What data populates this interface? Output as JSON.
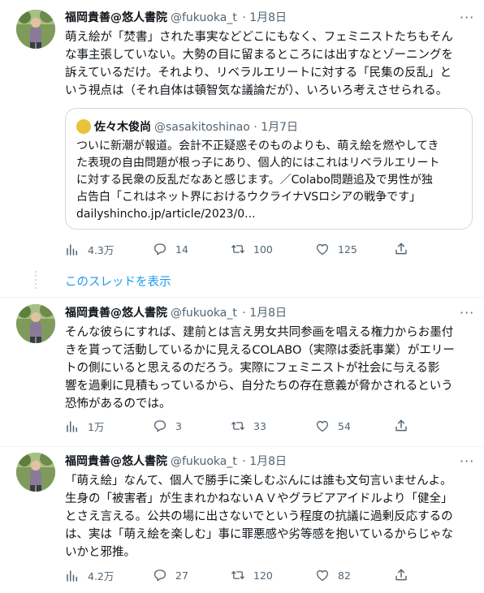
{
  "tweets": [
    {
      "name": "福岡貴善@悠人書院",
      "handle": "@fukuoka_t",
      "date": "· 1月8日",
      "text": "萌え絵が「焚書」された事実などどこにもなく、フェミニストたちもそん\nな事主張していない。大勢の目に留まるところには出すなとゾーニングを\n訴えているだけ。それより、リベラルエリートに対する「民集の反乱」と\nいう視点は（それ自体は頓智気な議論だが）、いろいろ考えさせられる。",
      "quote": {
        "name": "佐々木俊尚",
        "handle": "@sasakitoshinao",
        "date": "· 1月7日",
        "text": "ついに新潮が報道。会計不正疑惑そのものよりも、萌え絵を燃やしてき\nた表現の自由問題が根っ子にあり、個人的にはこれはリベラルエリート\nに対する民衆の反乱だなあと感じます。／Colabo問題追及で男性が独\n占告白「これはネット界におけるウクライナVSロシアの戦争です」\ndailyshincho.jp/article/2023/0..."
      },
      "views": "4.3万",
      "replies": "14",
      "retweets": "100",
      "likes": "125"
    },
    {
      "name": "福岡貴善@悠人書院",
      "handle": "@fukuoka_t",
      "date": "· 1月8日",
      "text": "そんな彼らにすれば、建前とは言え男女共同参画を唱える権力からお墨付\nきを貰って活動しているかに見えるCOLABO（実際は委託事業）がエリー\nトの側にいると思えるのだろう。実際にフェミニストが社会に与える影\n響を過剰に見積もっているから、自分たちの存在意義が脅かされるという\n恐怖があるのでは。",
      "views": "1万",
      "replies": "3",
      "retweets": "33",
      "likes": "54"
    },
    {
      "name": "福岡貴善@悠人書院",
      "handle": "@fukuoka_t",
      "date": "· 1月8日",
      "text": "「萌え絵」なんて、個人で勝手に楽しむぶんには誰も文句言いませんよ。\n生身の「被害者」が生まれかねないＡＶやグラビアアイドルより「健全」\nとさえ言える。公共の場に出さないでという程度の抗議に過剰反応するの\nは、実は「萌え絵を楽しむ」事に罪悪感や劣等感を抱いているからじゃな\nいかと邪推。",
      "views": "4.2万",
      "replies": "27",
      "retweets": "120",
      "likes": "82"
    }
  ],
  "thread_link": "このスレッドを表示",
  "more_label": "···"
}
